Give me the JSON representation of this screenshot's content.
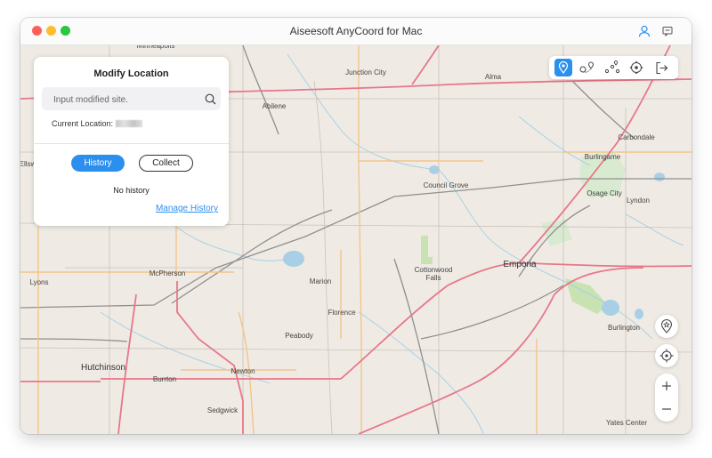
{
  "window": {
    "title": "Aiseesoft AnyCoord for Mac"
  },
  "panel": {
    "title": "Modify Location",
    "search_placeholder": "Input modified site.",
    "current_location_label": "Current Location:",
    "tabs": [
      {
        "label": "History",
        "active": true
      },
      {
        "label": "Collect",
        "active": false
      }
    ],
    "empty_text": "No history",
    "manage_link": "Manage History"
  },
  "toolbar": {
    "tools": [
      {
        "icon": "modify-location-icon",
        "active": true
      },
      {
        "icon": "one-stop-mode-icon",
        "active": false
      },
      {
        "icon": "multi-stop-mode-icon",
        "active": false
      },
      {
        "icon": "joystick-mode-icon",
        "active": false
      },
      {
        "icon": "exit-icon",
        "active": false
      }
    ]
  },
  "map": {
    "towns": [
      {
        "name": "Minneapolis",
        "big": false
      },
      {
        "name": "Junction City",
        "big": false
      },
      {
        "name": "Alma",
        "big": false
      },
      {
        "name": "Abilene",
        "big": false
      },
      {
        "name": "Carbondale",
        "big": false
      },
      {
        "name": "Burlingame",
        "big": false
      },
      {
        "name": "Council Grove",
        "big": false
      },
      {
        "name": "Osage City",
        "big": false
      },
      {
        "name": "Lyndon",
        "big": false
      },
      {
        "name": "Ellsw",
        "big": false
      },
      {
        "name": "McPherson",
        "big": false
      },
      {
        "name": "Lyons",
        "big": false
      },
      {
        "name": "Marion",
        "big": false
      },
      {
        "name": "Cottonwood",
        "big": false
      },
      {
        "name": "Falls",
        "big": false
      },
      {
        "name": "Emporia",
        "big": true
      },
      {
        "name": "Florence",
        "big": false
      },
      {
        "name": "Peabody",
        "big": false
      },
      {
        "name": "Burlington",
        "big": false
      },
      {
        "name": "Hutchinson",
        "big": true
      },
      {
        "name": "Burrton",
        "big": false
      },
      {
        "name": "Newton",
        "big": false
      },
      {
        "name": "Sedgwick",
        "big": false
      },
      {
        "name": "Yates Center",
        "big": false
      }
    ]
  },
  "colors": {
    "accent": "#2b8fee",
    "map_land": "#efebe4",
    "road_major": "#e8768a",
    "road_secondary": "#f2c58a",
    "water": "#a9cfe6",
    "park": "#c8e2b2"
  }
}
